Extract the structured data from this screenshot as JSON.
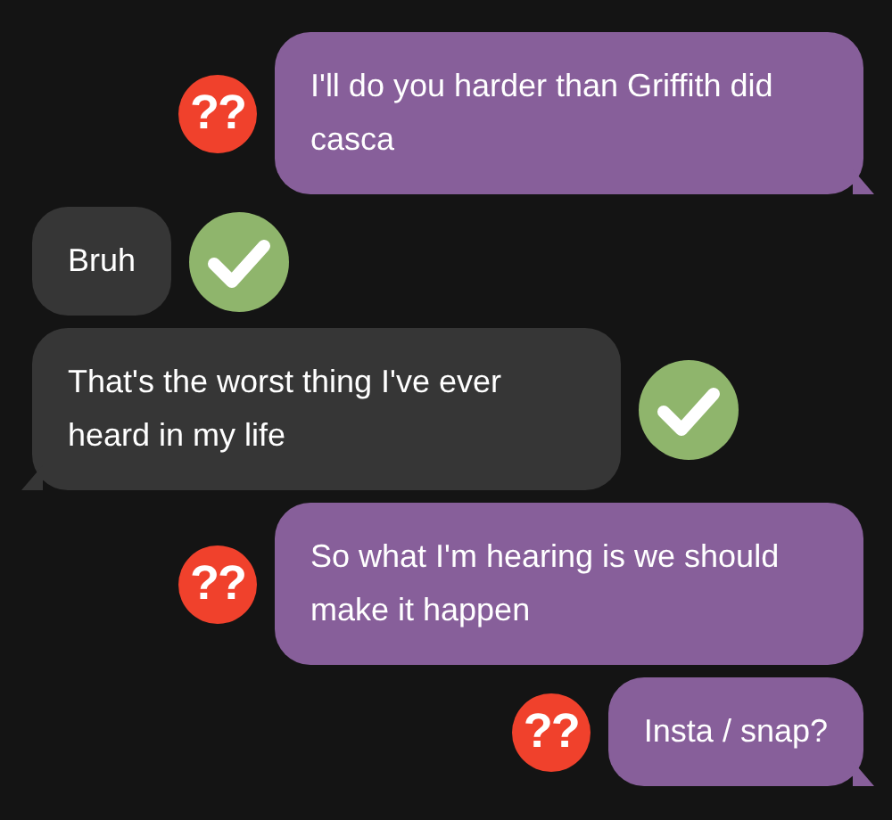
{
  "messages": [
    {
      "kind": "sent",
      "text": "I'll do you harder than Griffith did casca",
      "badge": "??",
      "tail": true
    },
    {
      "kind": "received",
      "text": "Bruh",
      "checked": true,
      "tail": false
    },
    {
      "kind": "received",
      "text": "That's the worst thing I've ever heard in my life",
      "checked": true,
      "tail": true
    },
    {
      "kind": "sent",
      "text": "So what I'm hearing is we should make it happen",
      "badge": "??",
      "tail": false
    },
    {
      "kind": "sent",
      "text": "Insta / snap?",
      "badge": "??",
      "tail": true
    }
  ]
}
